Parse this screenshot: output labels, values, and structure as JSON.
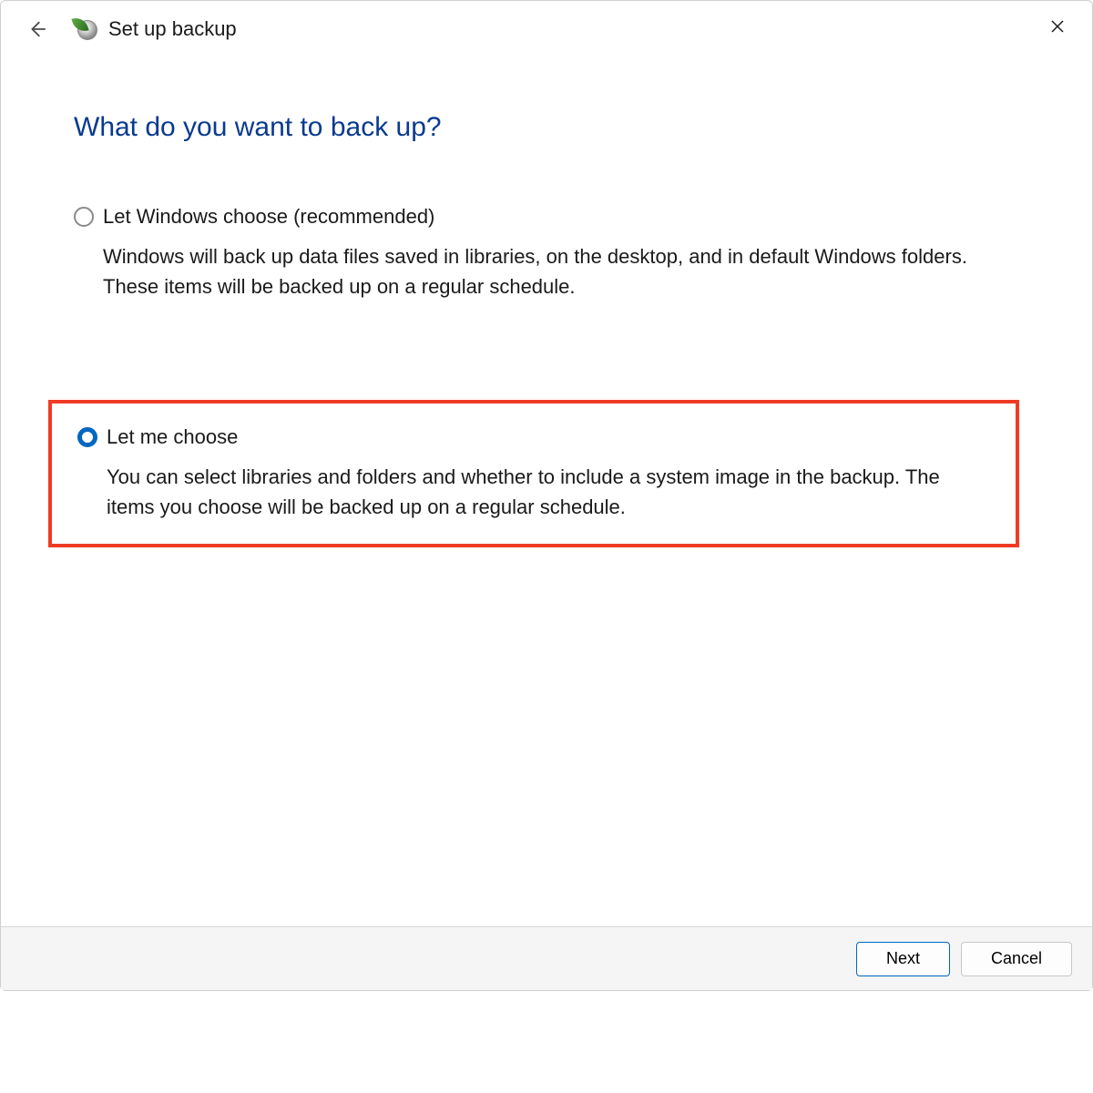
{
  "window_title": "Set up backup",
  "heading": "What do you want to back up?",
  "options": {
    "option1": {
      "label": "Let Windows choose (recommended)",
      "description": "Windows will back up data files saved in libraries, on the desktop, and in default Windows folders. These items will be backed up on a regular schedule.",
      "selected": false
    },
    "option2": {
      "label": "Let me choose",
      "description": "You can select libraries and folders and whether to include a system image in the backup. The items you choose will be backed up on a regular schedule.",
      "selected": true
    }
  },
  "buttons": {
    "next": "Next",
    "cancel": "Cancel"
  }
}
